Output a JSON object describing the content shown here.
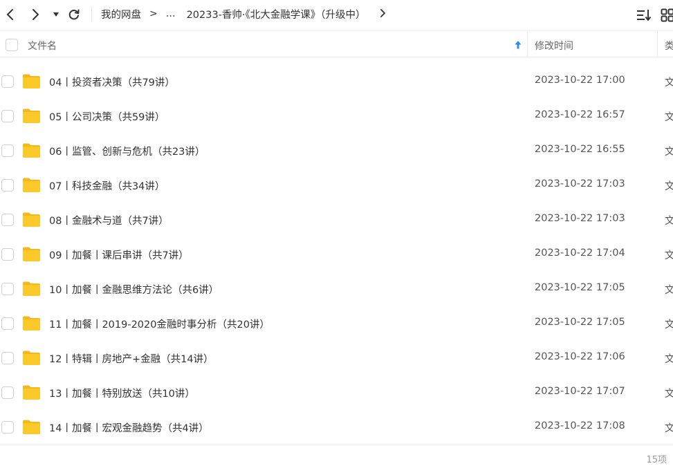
{
  "toolbar": {
    "back_icon": "chevron-left-icon",
    "forward_icon": "chevron-right-icon",
    "history_icon": "caret-down-icon",
    "refresh_icon": "refresh-icon",
    "sort_icon": "sort-list-icon",
    "view_icon": "grid-view-icon"
  },
  "breadcrumb": {
    "root": "我的网盘",
    "ellipsis": "...",
    "current": "20233-香帅·《北大金融学课》（升级中）",
    "separator": ">"
  },
  "header": {
    "name_label": "文件名",
    "time_label": "修改时间",
    "type_label": "类型",
    "sort_color": "#2c8cf4"
  },
  "files": [
    {
      "name": "04丨投资者决策（共79讲）",
      "modified": "2023-10-22 17:00",
      "type": "文件夹"
    },
    {
      "name": "05丨公司决策（共59讲）",
      "modified": "2023-10-22 16:57",
      "type": "文件夹"
    },
    {
      "name": "06丨监管、创新与危机（共23讲）",
      "modified": "2023-10-22 16:55",
      "type": "文件夹"
    },
    {
      "name": "07丨科技金融（共34讲）",
      "modified": "2023-10-22 17:03",
      "type": "文件夹"
    },
    {
      "name": "08丨金融术与道（共7讲）",
      "modified": "2023-10-22 17:03",
      "type": "文件夹"
    },
    {
      "name": "09丨加餐丨课后串讲（共7讲）",
      "modified": "2023-10-22 17:04",
      "type": "文件夹"
    },
    {
      "name": "10丨加餐丨金融思维方法论（共6讲）",
      "modified": "2023-10-22 17:05",
      "type": "文件夹"
    },
    {
      "name": "11丨加餐丨2019-2020金融时事分析（共20讲）",
      "modified": "2023-10-22 17:05",
      "type": "文件夹"
    },
    {
      "name": "12丨特辑丨房地产+金融（共14讲）",
      "modified": "2023-10-22 17:06",
      "type": "文件夹"
    },
    {
      "name": "13丨加餐丨特别放送（共10讲）",
      "modified": "2023-10-22 17:07",
      "type": "文件夹"
    },
    {
      "name": "14丨加餐丨宏观金融趋势（共4讲）",
      "modified": "2023-10-22 17:08",
      "type": "文件夹"
    }
  ],
  "footer": {
    "count": "15项"
  },
  "colors": {
    "folder": "#fcc92b",
    "folder_back": "#f5b71b"
  }
}
